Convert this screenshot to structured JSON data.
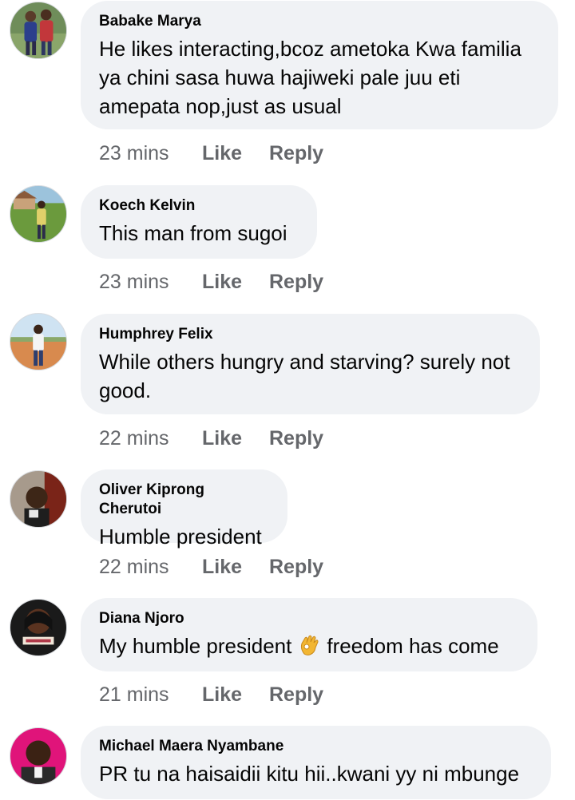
{
  "comments": [
    {
      "author": "Babake Marya",
      "text": "He likes interacting,bcoz ametoka Kwa familia ya chini sasa huwa hajiweki pale juu eti amepata nop,just as usual",
      "time": "23 mins",
      "like": "Like",
      "reply": "Reply"
    },
    {
      "author": "Koech Kelvin",
      "text": "This man from sugoi",
      "time": "23 mins",
      "like": "Like",
      "reply": "Reply"
    },
    {
      "author": "Humphrey Felix",
      "text": "While others hungry and starving? surely not good.",
      "time": "22 mins",
      "like": "Like",
      "reply": "Reply"
    },
    {
      "author": "Oliver Kiprong Cherutoi",
      "text": "Humble president",
      "time": "22 mins",
      "like": "Like",
      "reply": "Reply"
    },
    {
      "author": "Diana Njoro",
      "text_before": "My humble president",
      "emoji": "ok-hand-emoji",
      "text_after": "freedom has come",
      "time": "21 mins",
      "like": "Like",
      "reply": "Reply"
    },
    {
      "author": "Michael Maera Nyambane",
      "text": "PR tu na haisaidii kitu hii..kwani yy ni mbunge"
    }
  ],
  "colors": {
    "bubble": "#f0f2f5",
    "meta": "#65676b",
    "text": "#050505"
  }
}
